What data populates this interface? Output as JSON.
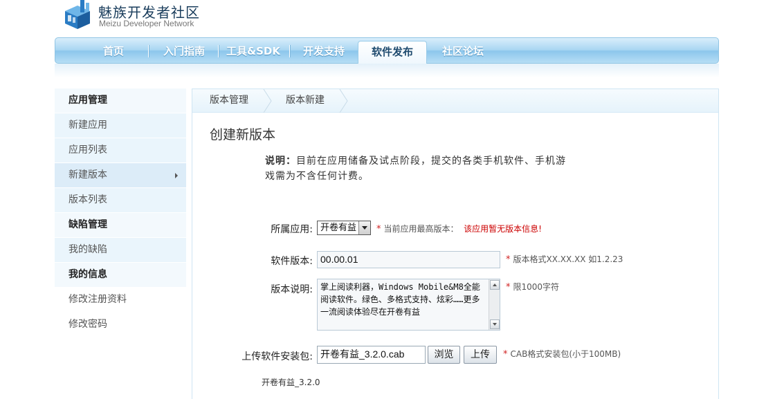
{
  "header": {
    "title": "魅族开发者社区",
    "subtitle": "Meizu Developer Network"
  },
  "nav": [
    {
      "label": "首页",
      "active": false
    },
    {
      "label": "入门指南",
      "active": false
    },
    {
      "label": "工具&SDK",
      "active": false
    },
    {
      "label": "开发支持",
      "active": false
    },
    {
      "label": "软件发布",
      "active": true
    },
    {
      "label": "社区论坛",
      "active": false
    }
  ],
  "sidebar": [
    {
      "label": "应用管理",
      "type": "head"
    },
    {
      "label": "新建应用",
      "type": "item"
    },
    {
      "label": "应用列表",
      "type": "item"
    },
    {
      "label": "新建版本",
      "type": "active"
    },
    {
      "label": "版本列表",
      "type": "item"
    },
    {
      "label": "缺陷管理",
      "type": "head"
    },
    {
      "label": "我的缺陷",
      "type": "item"
    },
    {
      "label": "我的信息",
      "type": "head"
    },
    {
      "label": "修改注册资料",
      "type": "plain"
    },
    {
      "label": "修改密码",
      "type": "plain"
    }
  ],
  "breadcrumb": [
    "版本管理",
    "版本新建"
  ],
  "page_title": "创建新版本",
  "note": {
    "label": "说明：",
    "text": "目前在应用储备及试点阶段，提交的各类手机软件、手机游戏需为不含任何计费。"
  },
  "form": {
    "app": {
      "label": "所属应用:",
      "value": "开卷有益",
      "hint_prefix": "当前应用最高版本：",
      "hint_value": "该应用暂无版本信息!"
    },
    "version": {
      "label": "软件版本:",
      "value": "00.00.01",
      "hint": "版本格式XX.XX.XX 如1.2.23"
    },
    "description": {
      "label": "版本说明:",
      "value": "掌上阅读利器，Windows Mobile&M8全能阅读软件。绿色、多格式支持、炫彩……更多一流阅读体验尽在开卷有益",
      "hint": "限1000字符"
    },
    "upload": {
      "label": "上传软件安装包:",
      "value": "开卷有益_3.2.0.cab",
      "browse_label": "浏览",
      "upload_label": "上传",
      "hint": "CAB格式安装包(小于100MB)"
    },
    "uploaded_name": "开卷有益_3.2.0"
  },
  "required_mark": "*",
  "colors": {
    "nav_blue": "#8cc6ec",
    "required_red": "#d02020",
    "sidebar_bg": "#eaf5fc"
  }
}
